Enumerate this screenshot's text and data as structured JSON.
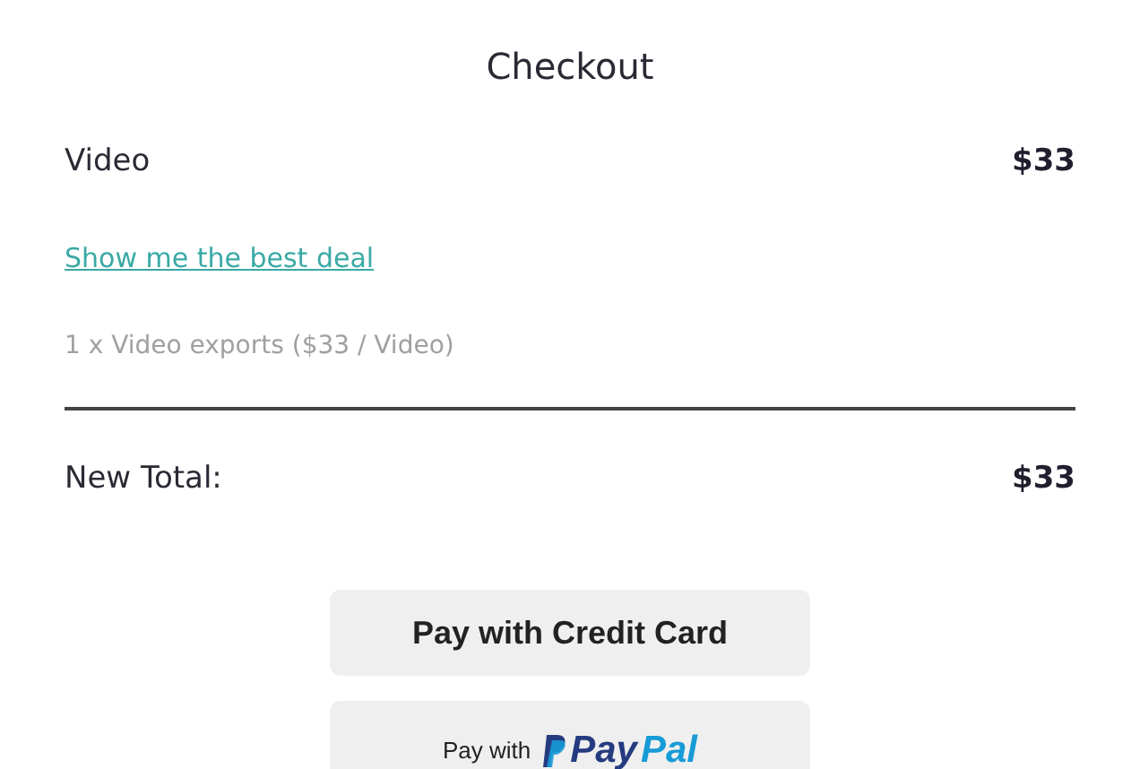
{
  "title": "Checkout",
  "item": {
    "name": "Video",
    "price": "$33"
  },
  "deal_link": "Show me the best deal",
  "description": "1 x Video exports ($33 / Video)",
  "total": {
    "label": "New Total:",
    "amount": "$33"
  },
  "buttons": [
    {
      "kind": "text",
      "label": "Pay with Credit Card"
    },
    {
      "kind": "paypal",
      "label": "Pay with",
      "brand_first": "Pay",
      "brand_second": "Pal"
    }
  ]
}
